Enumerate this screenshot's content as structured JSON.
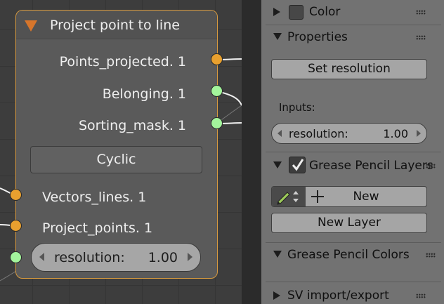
{
  "node": {
    "title": "Project point to line",
    "outputs": [
      {
        "label": "Points_projected. 1",
        "type": "vertices"
      },
      {
        "label": "Belonging. 1",
        "type": "strings"
      },
      {
        "label": "Sorting_mask. 1",
        "type": "strings"
      }
    ],
    "button_label": "Cyclic",
    "inputs": [
      {
        "label": "Vectors_lines. 1",
        "type": "vertices"
      },
      {
        "label": "Project_points. 1",
        "type": "vertices"
      }
    ],
    "resolution_field": {
      "label": "resolution:",
      "value": "1.00"
    }
  },
  "panel": {
    "color_section": {
      "title": "Color",
      "expanded": false,
      "checked": false
    },
    "properties_section": {
      "title": "Properties",
      "expanded": true,
      "set_resolution_button": "Set resolution",
      "inputs_label": "Inputs:",
      "resolution_field": {
        "label": "resolution:",
        "value": "1.00"
      }
    },
    "grease_pencil_layers": {
      "title": "Grease Pencil Layers",
      "expanded": true,
      "checked": true,
      "new_button": "New",
      "new_layer_button": "New Layer"
    },
    "grease_pencil_colors": {
      "title": "Grease Pencil Colors",
      "expanded": true
    },
    "sv_import_export": {
      "title": "SV import/export",
      "expanded": false
    }
  },
  "colors": {
    "node_border": "#d79a3f",
    "socket_vertices": "#e8a02f",
    "socket_strings": "#a3f59c",
    "collapse_triangle": "#d6752b"
  }
}
